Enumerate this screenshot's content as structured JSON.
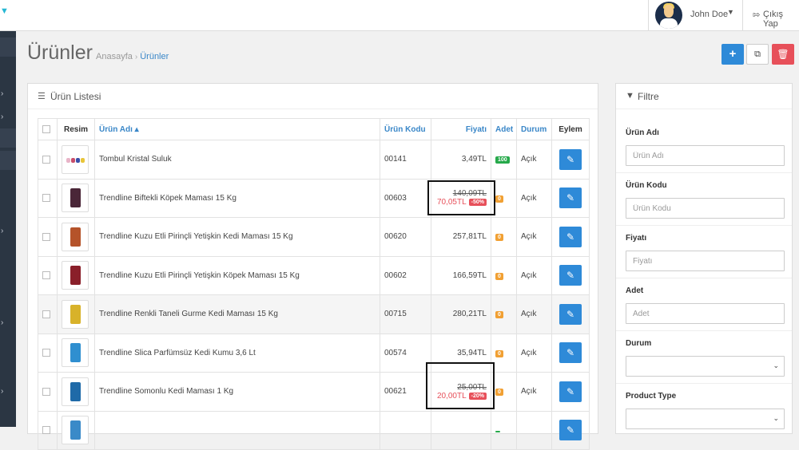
{
  "header": {
    "user_name": "John Doe",
    "logout_label": "Çıkış Yap"
  },
  "page": {
    "title": "Ürünler",
    "breadcrumb_home": "Anasayfa",
    "breadcrumb_current": "Ürünler"
  },
  "list_panel": {
    "title": "Ürün Listesi",
    "columns": {
      "image": "Resim",
      "name": "Ürün Adı",
      "code": "Ürün Kodu",
      "price": "Fiyatı",
      "qty": "Adet",
      "status": "Durum",
      "action": "Eylem"
    },
    "rows": [
      {
        "name": "Tombul Kristal Suluk",
        "code": "00141",
        "price": "3,49TL",
        "qty": "100",
        "status": "Açık"
      },
      {
        "name": "Trendline Biftekli Köpek Maması 15 Kg",
        "code": "00603",
        "old_price": "140,09TL",
        "new_price": "70,05TL",
        "discount": "-50%",
        "qty": "0",
        "status": "Açık"
      },
      {
        "name": "Trendline Kuzu Etli Pirinçli Yetişkin Kedi Maması 15 Kg",
        "code": "00620",
        "price": "257,81TL",
        "qty": "0",
        "status": "Açık"
      },
      {
        "name": "Trendline Kuzu Etli Pirinçli Yetişkin Köpek Maması 15 Kg",
        "code": "00602",
        "price": "166,59TL",
        "qty": "0",
        "status": "Açık"
      },
      {
        "name": "Trendline Renkli Taneli Gurme Kedi Maması 15 Kg",
        "code": "00715",
        "price": "280,21TL",
        "qty": "0",
        "status": "Açık"
      },
      {
        "name": "Trendline Slica Parfümsüz Kedi Kumu 3,6 Lt",
        "code": "00574",
        "price": "35,94TL",
        "qty": "0",
        "status": "Açık"
      },
      {
        "name": "Trendline Somonlu Kedi Maması 1 Kg",
        "code": "00621",
        "old_price": "25,00TL",
        "new_price": "20,00TL",
        "discount": "-20%",
        "qty": "0",
        "status": "Açık"
      }
    ]
  },
  "filter_panel": {
    "title": "Filtre",
    "fields": [
      {
        "label": "Ürün Adı",
        "placeholder": "Ürün Adı"
      },
      {
        "label": "Ürün Kodu",
        "placeholder": "Ürün Kodu"
      },
      {
        "label": "Fiyatı",
        "placeholder": "Fiyatı"
      },
      {
        "label": "Adet",
        "placeholder": "Adet"
      },
      {
        "label": "Durum"
      },
      {
        "label": "Product Type"
      }
    ]
  },
  "icons": {
    "add": "plus-icon",
    "copy": "copy-icon",
    "delete": "trash-icon",
    "edit": "pencil-icon",
    "list": "list-icon",
    "filter": "funnel-icon",
    "logout": "logout-icon"
  },
  "colors": {
    "primary": "#2e8ad8",
    "danger": "#e7505a",
    "qty_ok": "#26a94a",
    "qty_zero": "#f1a033",
    "sidebar": "#2b3643"
  }
}
